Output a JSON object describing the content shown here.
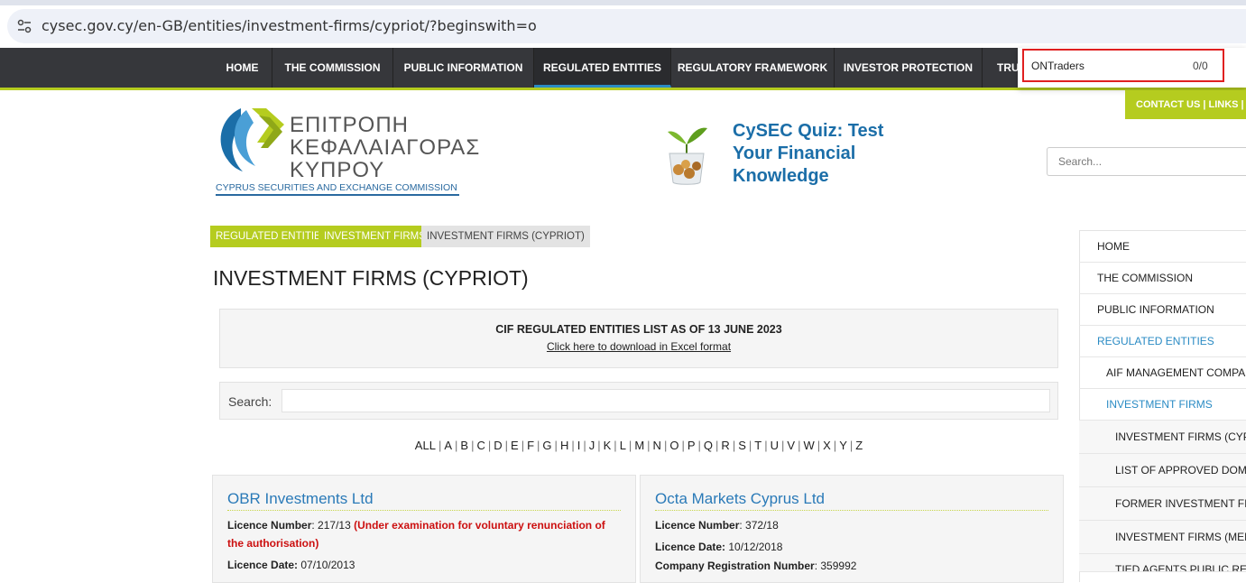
{
  "browser": {
    "url": "cysec.gov.cy/en-GB/entities/investment-firms/cypriot/?beginswith=o",
    "find_query": "ONTraders",
    "find_count": "0/0"
  },
  "nav": {
    "items": [
      "HOME",
      "THE COMMISSION",
      "PUBLIC INFORMATION",
      "REGULATED ENTITIES",
      "REGULATORY FRAMEWORK",
      "INVESTOR PROTECTION",
      "TRU"
    ],
    "active": "REGULATED ENTITIES",
    "contact_links": "CONTACT US  |  LINKS  |"
  },
  "logo": {
    "greek_lines": [
      "ΕΠΙΤΡΟΠΗ",
      "ΚΕΦΑΛΑΙΑΓΟΡΑΣ",
      "ΚΥΠΡΟΥ"
    ],
    "english": "CYPRUS SECURITIES AND EXCHANGE COMMISSION"
  },
  "quiz": {
    "text": "CySEC Quiz: Test Your Financial Knowledge"
  },
  "header_search": {
    "placeholder": "Search..."
  },
  "breadcrumb": [
    "REGULATED ENTITIES",
    "INVESTMENT FIRMS",
    "INVESTMENT FIRMS (CYPRIOT)"
  ],
  "page_title": "INVESTMENT FIRMS (CYPRIOT)",
  "list_info": {
    "title": "CIF REGULATED ENTITIES LIST AS OF 13 JUNE 2023",
    "download_link": "Click here to download in Excel format"
  },
  "search": {
    "label": "Search:",
    "value": ""
  },
  "alphabet": [
    "ALL",
    "A",
    "B",
    "C",
    "D",
    "E",
    "F",
    "G",
    "H",
    "I",
    "J",
    "K",
    "L",
    "M",
    "N",
    "O",
    "P",
    "Q",
    "R",
    "S",
    "T",
    "U",
    "V",
    "W",
    "X",
    "Y",
    "Z"
  ],
  "cards": [
    {
      "name": "OBR Investments Ltd",
      "licence_number_label": "Licence Number",
      "licence_number": "217/13",
      "status_note": "(Under examination for voluntary renunciation of the authorisation)",
      "licence_date_label": "Licence Date:",
      "licence_date": "07/10/2013"
    },
    {
      "name": "Octa Markets Cyprus Ltd",
      "licence_number_label": "Licence Number",
      "licence_number": "372/18",
      "licence_date_label": "Licence Date:",
      "licence_date": "10/12/2018",
      "company_reg_label": "Company Registration Number",
      "company_reg": "359992"
    }
  ],
  "sidebar": {
    "items": [
      {
        "label": "HOME"
      },
      {
        "label": "THE COMMISSION"
      },
      {
        "label": "PUBLIC INFORMATION"
      },
      {
        "label": "REGULATED ENTITIES"
      },
      {
        "label": "AIF MANAGEMENT COMPANIES"
      },
      {
        "label": "INVESTMENT FIRMS"
      },
      {
        "label": "INVESTMENT FIRMS (CYPRIOT)"
      },
      {
        "label": "LIST OF APPROVED DOMAINS"
      },
      {
        "label": "FORMER INVESTMENT FIRMS (CYPRIOT)"
      },
      {
        "label": "INVESTMENT FIRMS (MEMBER STATES)"
      },
      {
        "label": "TIED AGENTS PUBLIC REGISTER"
      }
    ]
  },
  "colors": {
    "nav_bg": "#36373b",
    "accent_green": "#b5cc1f",
    "link_blue": "#2a8bc4",
    "alert_red": "#cc1010"
  }
}
